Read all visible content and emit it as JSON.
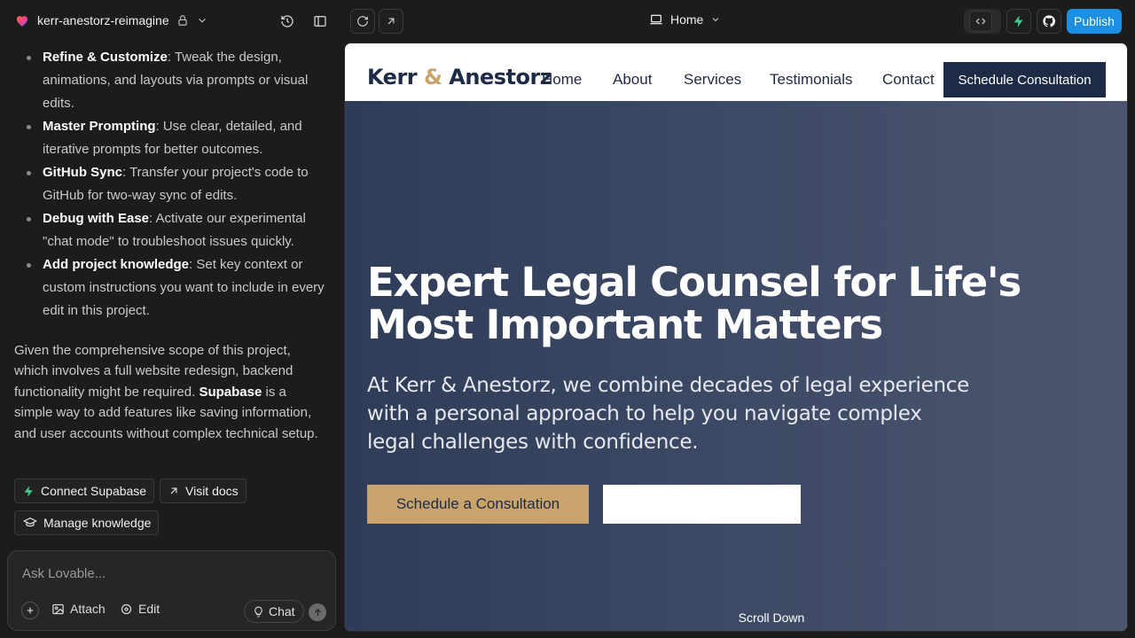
{
  "topbar": {
    "project_name": "kerr-anestorz-reimagine",
    "page_selector": "Home",
    "publish_label": "Publish"
  },
  "chat": {
    "tips": [
      {
        "title": "Refine & Customize",
        "text": ": Tweak the design, animations, and layouts via prompts or visual edits."
      },
      {
        "title": "Master Prompting",
        "text": ": Use clear, detailed, and iterative prompts for better outcomes."
      },
      {
        "title": "GitHub Sync",
        "text": ": Transfer your project's code to GitHub for two-way sync of edits."
      },
      {
        "title": "Debug with Ease",
        "text": ": Activate our experimental \"chat mode\" to troubleshoot issues quickly."
      },
      {
        "title": "Add project knowledge",
        "text": ": Set key context or custom instructions you want to include in every edit in this project."
      }
    ],
    "para_before": "Given the comprehensive scope of this project, which involves a full website redesign, backend functionality might be required. ",
    "para_bold": "Supabase",
    "para_after": " is a simple way to add features like saving information, and user accounts without complex technical setup.",
    "connect_supabase": "Connect Supabase",
    "visit_docs": "Visit docs",
    "manage_knowledge": "Manage knowledge",
    "composer_placeholder": "Ask Lovable...",
    "attach_label": "Attach",
    "edit_label": "Edit",
    "chat_label": "Chat"
  },
  "site": {
    "logo_left": "Kerr ",
    "logo_amp": "&",
    "logo_right": " Anestorz",
    "nav": [
      "Home",
      "About",
      "Services",
      "Testimonials",
      "Contact"
    ],
    "nav_cta": "Schedule Consultation",
    "hero_title": "Expert Legal Counsel for Life's Most Important Matters",
    "hero_text": "At Kerr & Anestorz, we combine decades of legal experience with a personal approach to help you navigate complex legal challenges with confidence.",
    "btn_primary": "Schedule a Consultation",
    "btn_secondary": "",
    "scroll_label": "Scroll Down"
  },
  "colors": {
    "navy": "#1e2b46",
    "gold": "#c8a46c",
    "publish_blue": "#1a8fe3"
  }
}
